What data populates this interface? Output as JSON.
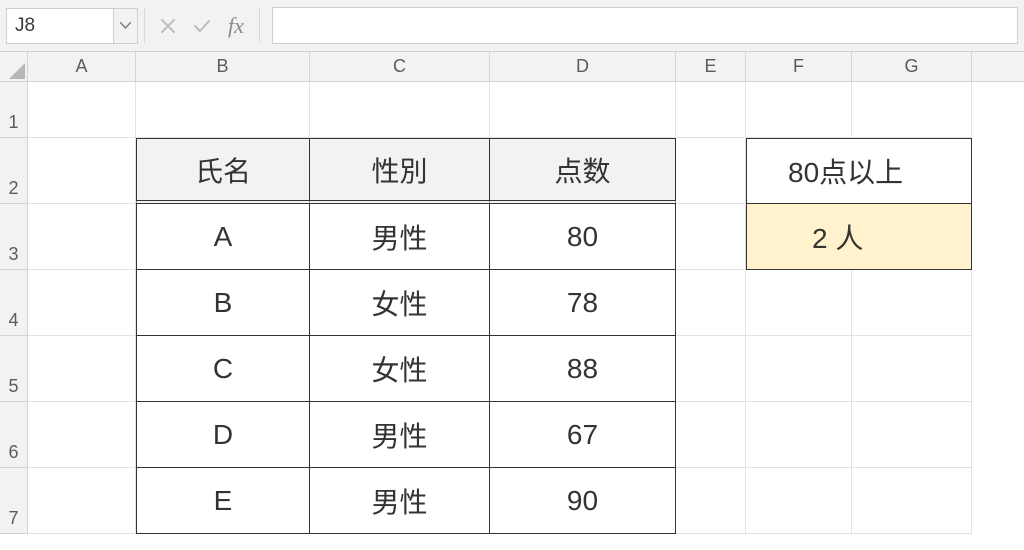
{
  "formula_bar": {
    "name_box_value": "J8",
    "cancel_aria": "Cancel",
    "enter_aria": "Enter",
    "fx_label": "fx",
    "formula_value": ""
  },
  "columns": [
    "A",
    "B",
    "C",
    "D",
    "E",
    "F",
    "G"
  ],
  "row_numbers": [
    "1",
    "2",
    "3",
    "4",
    "5",
    "6",
    "7"
  ],
  "table": {
    "headers": {
      "name": "氏名",
      "gender": "性別",
      "score": "点数"
    },
    "rows": [
      {
        "name": "A",
        "gender": "男性",
        "score": "80"
      },
      {
        "name": "B",
        "gender": "女性",
        "score": "78"
      },
      {
        "name": "C",
        "gender": "女性",
        "score": "88"
      },
      {
        "name": "D",
        "gender": "男性",
        "score": "67"
      },
      {
        "name": "E",
        "gender": "男性",
        "score": "90"
      }
    ]
  },
  "summary": {
    "label": "80点以上",
    "value": "2 人"
  }
}
